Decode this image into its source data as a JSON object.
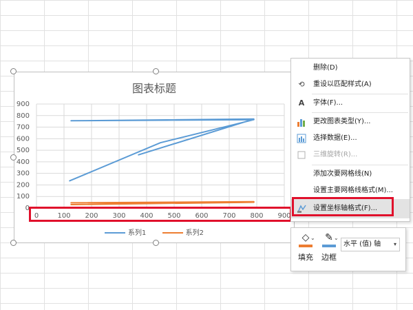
{
  "chart": {
    "title": "图表标题",
    "legend": [
      {
        "name": "系列1",
        "color": "#5b9bd5"
      },
      {
        "name": "系列2",
        "color": "#ed7d31"
      }
    ]
  },
  "chart_data": {
    "type": "scatter",
    "title": "图表标题",
    "xlabel": "",
    "ylabel": "",
    "xlim": [
      0,
      900
    ],
    "ylim": [
      0,
      900
    ],
    "xticks": [
      0,
      100,
      200,
      300,
      400,
      500,
      600,
      700,
      800,
      900
    ],
    "yticks": [
      0,
      100,
      200,
      300,
      400,
      500,
      600,
      700,
      800,
      900
    ],
    "grid": true,
    "legend_position": "bottom",
    "series": [
      {
        "name": "系列1",
        "color": "#5b9bd5",
        "points": [
          [
            120,
            235
          ],
          [
            450,
            565
          ],
          [
            790,
            765
          ],
          [
            125,
            755
          ],
          [
            790,
            770
          ],
          [
            370,
            460
          ]
        ]
      },
      {
        "name": "系列2",
        "color": "#ed7d31",
        "points": [
          [
            125,
            30
          ],
          [
            790,
            50
          ],
          [
            125,
            45
          ],
          [
            790,
            55
          ]
        ]
      }
    ]
  },
  "context_menu": {
    "items": [
      {
        "label": "删除(D)",
        "icon": "none",
        "disabled": false
      },
      {
        "label": "重设以匹配样式(A)",
        "icon": "reset-style-icon",
        "disabled": false
      },
      {
        "label": "字体(F)...",
        "icon": "font-icon",
        "disabled": false
      },
      {
        "label": "更改图表类型(Y)...",
        "icon": "chart-type-icon",
        "disabled": false
      },
      {
        "label": "选择数据(E)...",
        "icon": "select-data-icon",
        "disabled": false
      },
      {
        "label": "三维旋转(R)...",
        "icon": "3d-rotation-icon",
        "disabled": true
      },
      {
        "label": "添加次要网格线(N)",
        "icon": "none",
        "disabled": false
      },
      {
        "label": "设置主要网格线格式(M)...",
        "icon": "none",
        "disabled": false
      },
      {
        "label": "设置坐标轴格式(F)...",
        "icon": "format-axis-icon",
        "disabled": false
      }
    ]
  },
  "mini_toolbar": {
    "fill_label": "填充",
    "border_label": "边框",
    "fill_color": "#ed7d31",
    "border_color": "#5b9bd5",
    "axis_selector": "水平 (值) 轴"
  }
}
